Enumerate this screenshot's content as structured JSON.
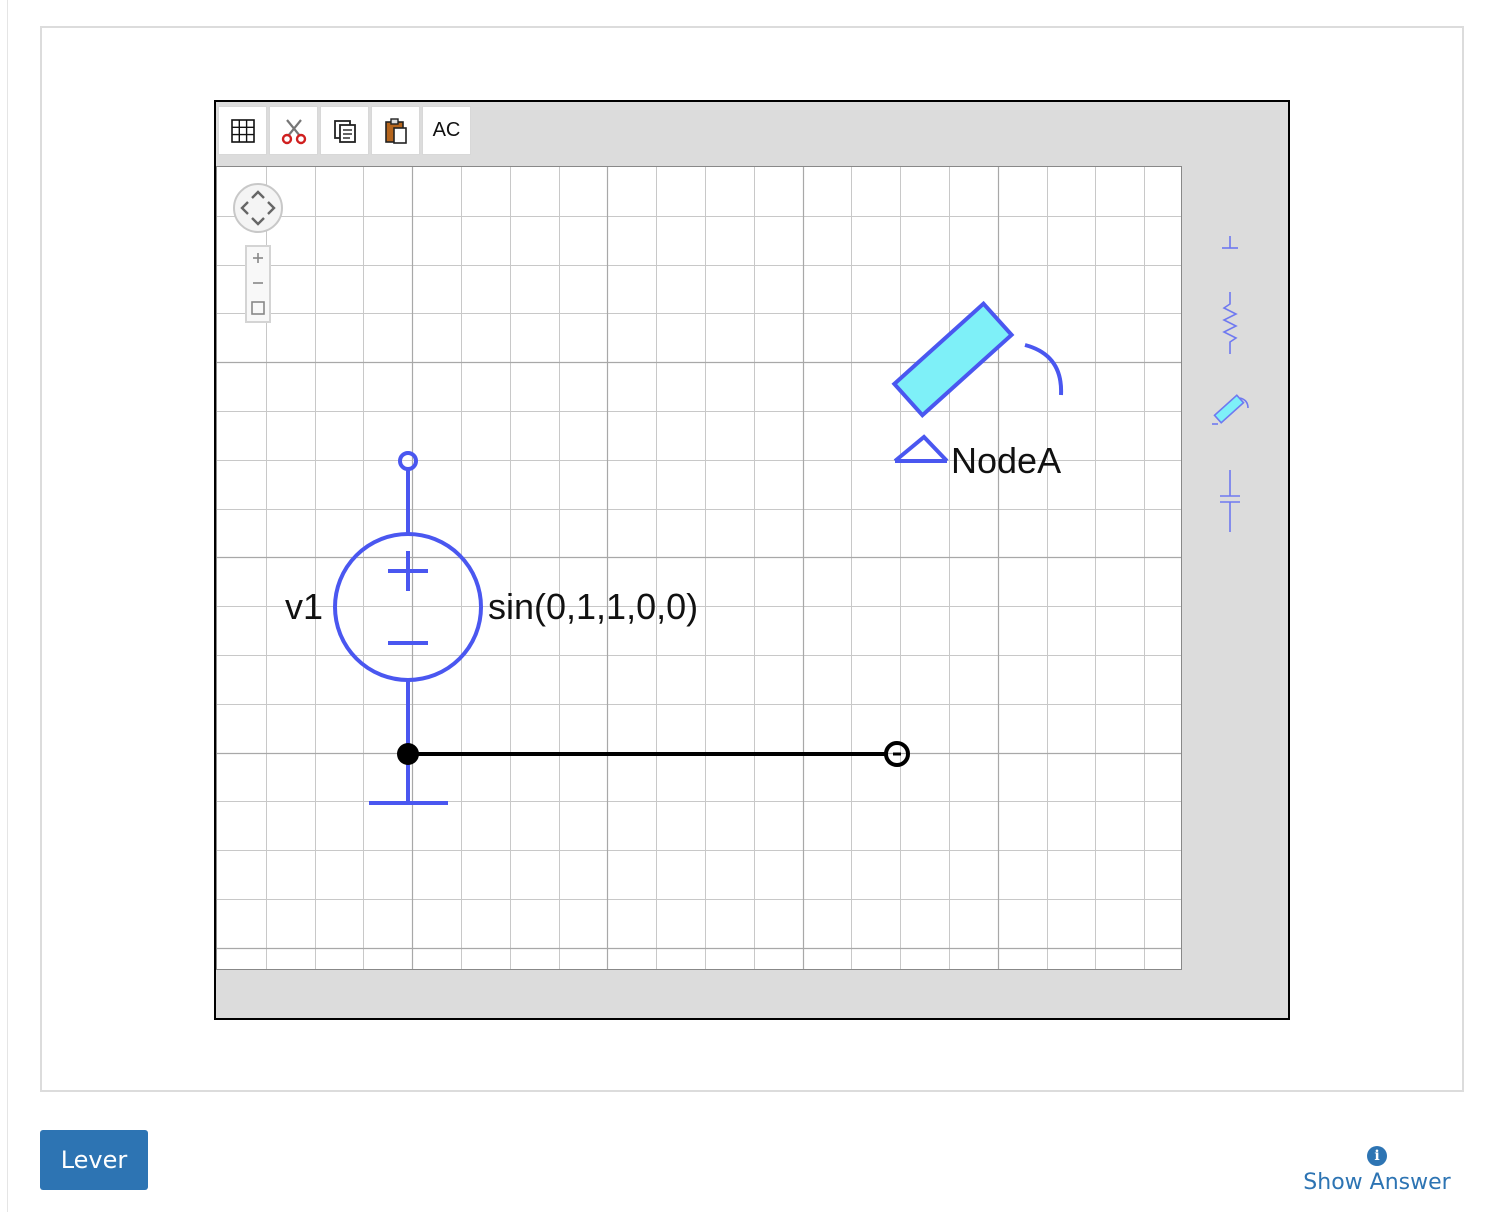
{
  "toolbar": {
    "grid_label": "grid",
    "cut_label": "cut",
    "copy_label": "copy",
    "paste_label": "paste",
    "ac_label": "AC"
  },
  "circuit": {
    "source_name": "v1",
    "source_value": "sin(0,1,1,0,0)",
    "probe_label": "NodeA"
  },
  "actions": {
    "submit_label": "Lever",
    "show_answer_label": "Show Answer"
  },
  "colors": {
    "component": "#4a57f0",
    "probe_fill": "#7ef0f8",
    "wire": "#000000",
    "button": "#2d74b3",
    "panel": "#dcdcdc"
  },
  "icons": {
    "grid": "grid-icon",
    "cut": "scissors-icon",
    "copy": "copy-icon",
    "paste": "clipboard-icon",
    "info": "info-icon"
  }
}
